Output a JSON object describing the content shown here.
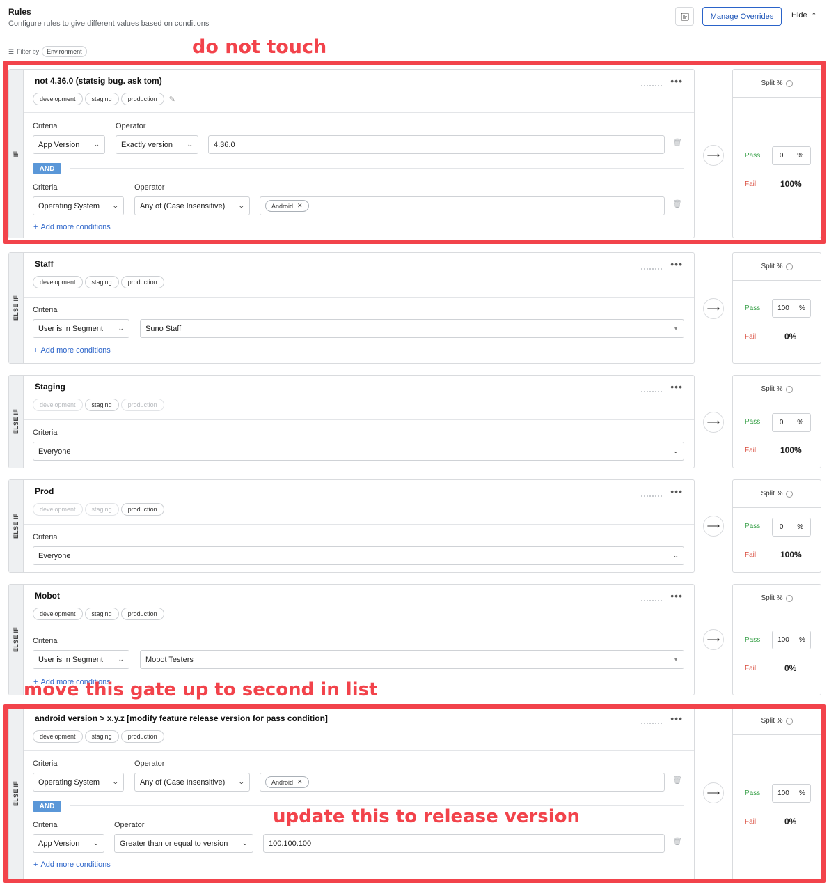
{
  "header": {
    "title": "Rules",
    "subtitle": "Configure rules to give different values based on conditions",
    "manage_overrides": "Manage Overrides",
    "hide": "Hide",
    "filter_by": "Filter by",
    "filter_chip": "Environment"
  },
  "common": {
    "criteria": "Criteria",
    "operator": "Operator",
    "and": "AND",
    "add_more": "Add more conditions",
    "split": "Split %",
    "pass": "Pass",
    "fail": "Fail",
    "percent": "%",
    "env_dev": "development",
    "env_staging": "staging",
    "env_prod": "production"
  },
  "rules": [
    {
      "type": "IF",
      "name": "not 4.36.0 (statsig bug. ask tom)",
      "c1_criteria": "App Version",
      "c1_operator": "Exactly version",
      "c1_value": "4.36.0",
      "c2_criteria": "Operating System",
      "c2_operator": "Any of (Case Insensitive)",
      "c2_tag": "Android",
      "pass": "0",
      "fail": "100%"
    },
    {
      "type": "ELSE IF",
      "name": "Staff",
      "criteria": "User is in Segment",
      "value": "Suno Staff",
      "pass": "100",
      "fail": "0%"
    },
    {
      "type": "ELSE IF",
      "name": "Staging",
      "criteria": "Everyone",
      "pass": "0",
      "fail": "100%"
    },
    {
      "type": "ELSE IF",
      "name": "Prod",
      "criteria": "Everyone",
      "pass": "0",
      "fail": "100%"
    },
    {
      "type": "ELSE IF",
      "name": "Mobot",
      "criteria": "User is in Segment",
      "value": "Mobot Testers",
      "pass": "100",
      "fail": "0%"
    },
    {
      "type": "ELSE IF",
      "name": "android version > x.y.z [modify feature release version for pass condition]",
      "c1_criteria": "Operating System",
      "c1_operator": "Any of (Case Insensitive)",
      "c1_tag": "Android",
      "c2_criteria": "App Version",
      "c2_operator": "Greater than or equal to version",
      "c2_value": "100.100.100",
      "pass": "100",
      "fail": "0%"
    }
  ],
  "annotations": {
    "a1": "do not touch",
    "a2": "move this gate up to second in list",
    "a3": "update this to release version",
    "color": "#f2434b"
  }
}
